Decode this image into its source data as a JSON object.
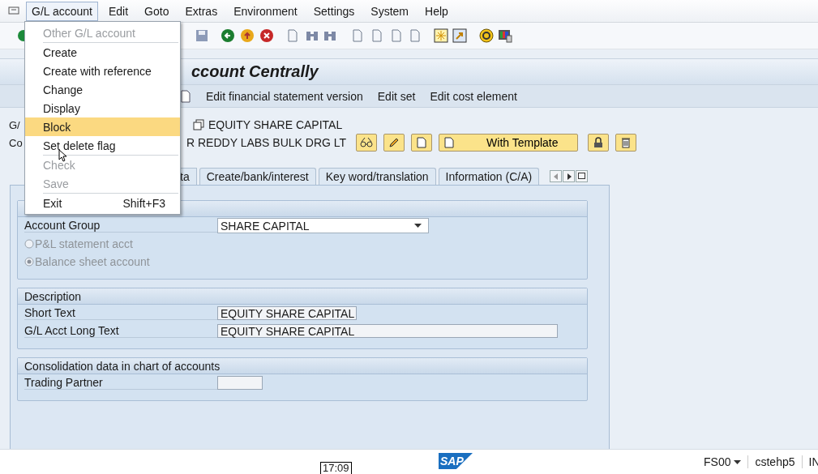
{
  "menu_bar": [
    {
      "label": "G/L account",
      "selected": true
    },
    {
      "label": "Edit",
      "selected": false
    },
    {
      "label": "Goto",
      "selected": false
    },
    {
      "label": "Extras",
      "selected": false
    },
    {
      "label": "Environment",
      "selected": false
    },
    {
      "label": "Settings",
      "selected": false
    },
    {
      "label": "System",
      "selected": false
    },
    {
      "label": "Help",
      "selected": false
    }
  ],
  "dropdown_menu": [
    {
      "label": "Other G/L account",
      "disabled": true,
      "highlighted": false,
      "separator_after": true
    },
    {
      "label": "Create",
      "disabled": false,
      "highlighted": false,
      "separator_after": false
    },
    {
      "label": "Create with reference",
      "disabled": false,
      "highlighted": false,
      "separator_after": false
    },
    {
      "label": "Change",
      "disabled": false,
      "highlighted": false,
      "separator_after": false
    },
    {
      "label": "Display",
      "disabled": false,
      "highlighted": false,
      "separator_after": false
    },
    {
      "label": "Block",
      "disabled": false,
      "highlighted": true,
      "separator_after": false
    },
    {
      "label": "Set delete flag",
      "disabled": false,
      "highlighted": false,
      "separator_after": true
    },
    {
      "label": "Check",
      "disabled": true,
      "highlighted": false,
      "separator_after": false
    },
    {
      "label": "Save",
      "disabled": true,
      "highlighted": false,
      "separator_after": true
    },
    {
      "label": "Exit",
      "shortcut": "Shift+F3",
      "disabled": false,
      "highlighted": false,
      "separator_after": false
    }
  ],
  "title": "ccount Centrally",
  "app_toolbar": [
    "Edit financial statement version",
    "Edit set",
    "Edit cost element"
  ],
  "header": {
    "row_labels": [
      "G/",
      "Co"
    ],
    "account_text": "EQUITY SHARE CAPITAL",
    "company_text": "R REDDY LABS BULK DRG LT",
    "template_button": "With Template"
  },
  "tabs": [
    {
      "label": "ta",
      "selected": false
    },
    {
      "label": "Create/bank/interest",
      "selected": false
    },
    {
      "label": "Key word/translation",
      "selected": false
    },
    {
      "label": "Information (C/A)",
      "selected": false
    }
  ],
  "groups": [
    {
      "rows": [
        {
          "kind": "dropdown",
          "label": "Account Group",
          "value": "SHARE CAPITAL"
        },
        {
          "kind": "radio",
          "label": "P&L statement acct",
          "selected": false,
          "disabled": true
        },
        {
          "kind": "radio",
          "label": "Balance sheet account",
          "selected": true,
          "disabled": true
        }
      ]
    },
    {
      "title": "Description",
      "rows": [
        {
          "kind": "field",
          "label": "Short Text",
          "value": "EQUITY SHARE CAPITAL"
        },
        {
          "kind": "field",
          "label": "G/L Acct Long Text",
          "value": "EQUITY SHARE CAPITAL"
        }
      ]
    },
    {
      "title": "Consolidation data in chart of accounts",
      "rows": [
        {
          "kind": "field",
          "label": "Trading Partner"
        }
      ]
    }
  ],
  "status_bar": {
    "logo": "SAP",
    "time_tooltip": "17:09",
    "transaction": "FS00",
    "server": "cstehp5",
    "mode": "IN"
  }
}
